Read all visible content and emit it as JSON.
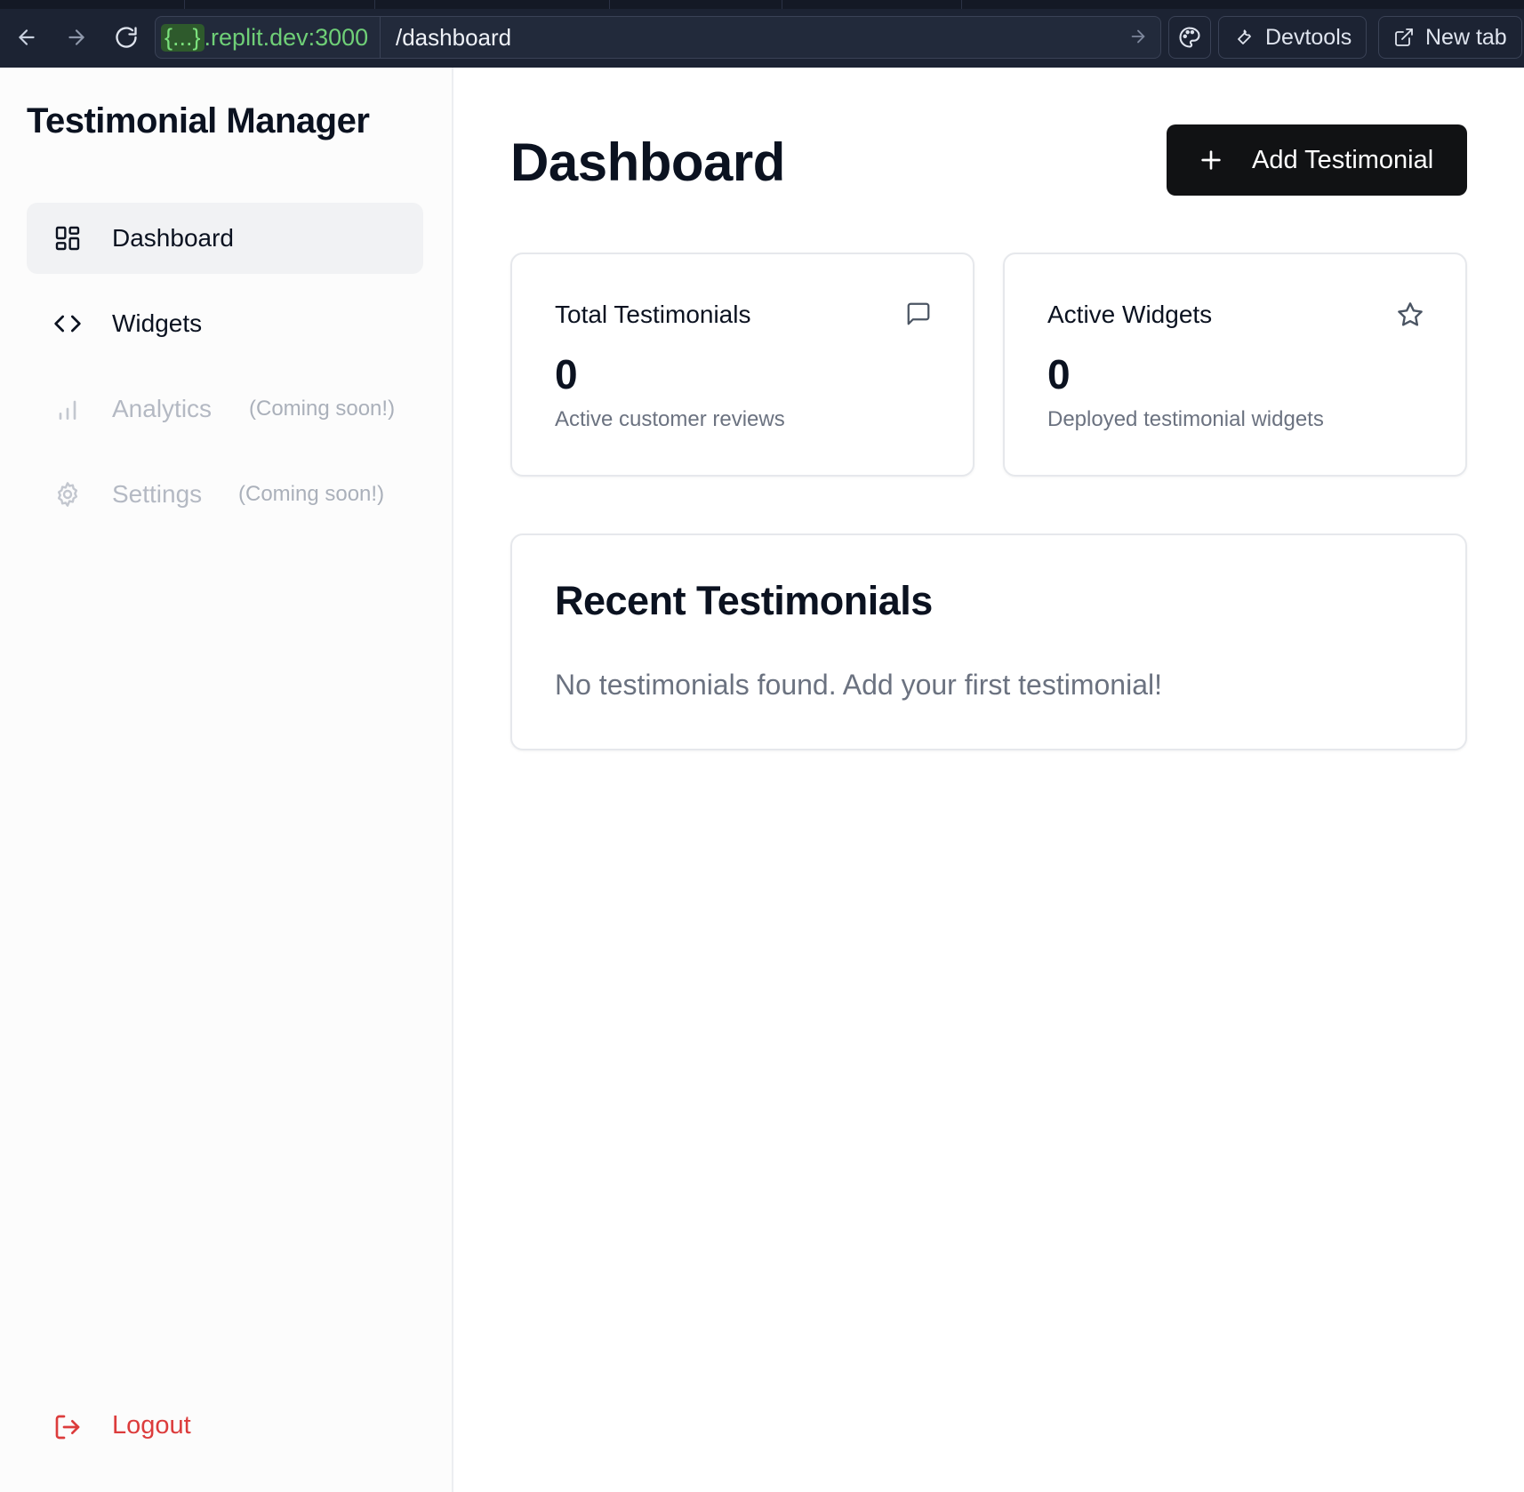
{
  "browser": {
    "url_host_badge": "{...}",
    "url_host": ".replit.dev:3000",
    "url_path": "/dashboard",
    "devtools_label": "Devtools",
    "new_tab_label": "New tab"
  },
  "sidebar": {
    "brand": "Testimonial Manager",
    "items": [
      {
        "label": "Dashboard",
        "icon": "layout-grid-icon",
        "active": true
      },
      {
        "label": "Widgets",
        "icon": "code-icon"
      },
      {
        "label": "Analytics",
        "icon": "bar-chart-icon",
        "note": "(Coming soon!)",
        "disabled": true
      },
      {
        "label": "Settings",
        "icon": "gear-icon",
        "note": "(Coming soon!)",
        "disabled": true
      }
    ],
    "logout_label": "Logout"
  },
  "main": {
    "title": "Dashboard",
    "add_button_label": "Add Testimonial",
    "stats": [
      {
        "title": "Total Testimonials",
        "value": "0",
        "description": "Active customer reviews",
        "icon": "message-square-icon"
      },
      {
        "title": "Active Widgets",
        "value": "0",
        "description": "Deployed testimonial widgets",
        "icon": "star-icon"
      }
    ],
    "recent": {
      "title": "Recent Testimonials",
      "empty_message": "No testimonials found. Add your first testimonial!"
    }
  },
  "colors": {
    "accent_dark": "#111214",
    "logout_red": "#dc3c3c",
    "url_green": "#6fcf77"
  }
}
